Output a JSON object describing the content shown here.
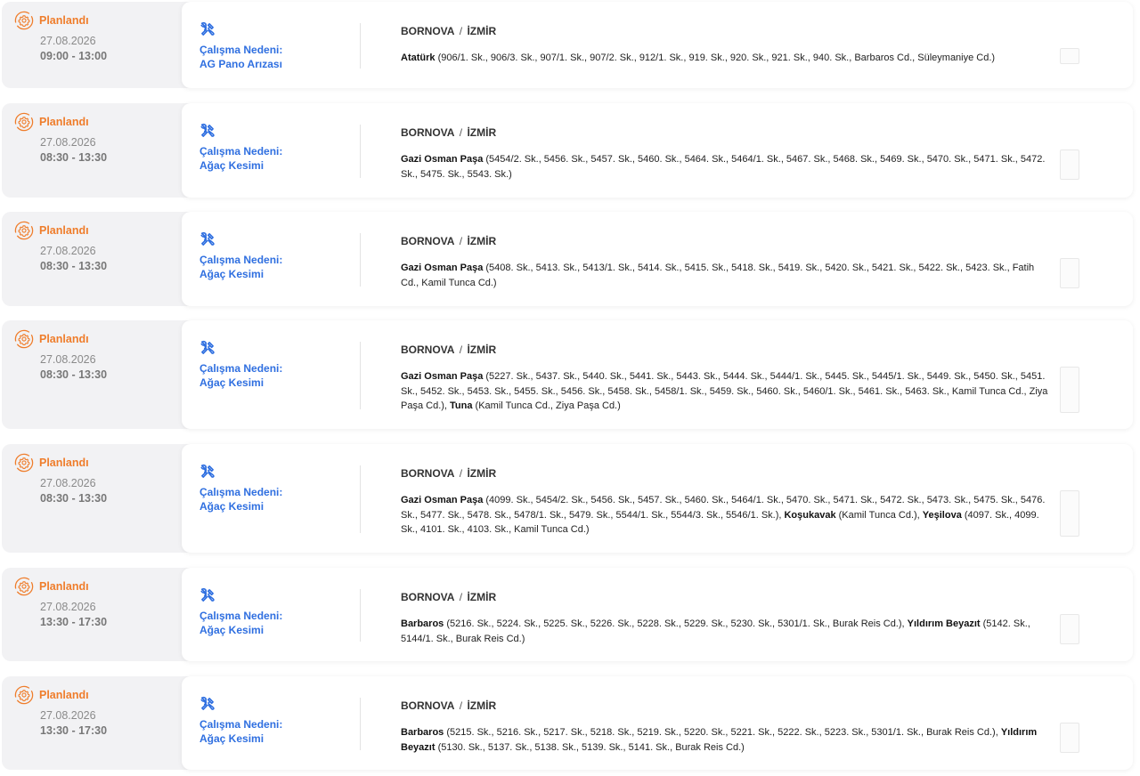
{
  "colors": {
    "status": "#ef7d2b",
    "reason": "#2f6fe0",
    "left_bg": "#f2f2f4"
  },
  "icons": {
    "status": "gear-refresh-icon",
    "reason": "tools-icon"
  },
  "outages": [
    {
      "status": "Planlandı",
      "date": "27.08.2026",
      "time": "09:00 - 13:00",
      "reason_label": "Çalışma Nedeni:",
      "reason": "AG Pano Arızası",
      "district": "BORNOVA",
      "city": "İZMİR",
      "segments": [
        {
          "name": "Atatürk",
          "streets": " (906/1. Sk., 906/3. Sk., 907/1. Sk., 907/2. Sk., 912/1. Sk., 919. Sk., 920. Sk., 921. Sk., 940. Sk., Barbaros Cd., Süleymaniye Cd.)"
        }
      ]
    },
    {
      "status": "Planlandı",
      "date": "27.08.2026",
      "time": "08:30 - 13:30",
      "reason_label": "Çalışma Nedeni:",
      "reason": "Ağaç Kesimi",
      "district": "BORNOVA",
      "city": "İZMİR",
      "segments": [
        {
          "name": "Gazi Osman Paşa",
          "streets": " (5454/2. Sk., 5456. Sk., 5457. Sk., 5460. Sk., 5464. Sk., 5464/1. Sk., 5467. Sk., 5468. Sk., 5469. Sk., 5470. Sk., 5471. Sk., 5472. Sk., 5475. Sk., 5543. Sk.)"
        }
      ]
    },
    {
      "status": "Planlandı",
      "date": "27.08.2026",
      "time": "08:30 - 13:30",
      "reason_label": "Çalışma Nedeni:",
      "reason": "Ağaç Kesimi",
      "district": "BORNOVA",
      "city": "İZMİR",
      "segments": [
        {
          "name": "Gazi Osman Paşa",
          "streets": " (5408. Sk., 5413. Sk., 5413/1. Sk., 5414. Sk., 5415. Sk., 5418. Sk., 5419. Sk., 5420. Sk., 5421. Sk., 5422. Sk., 5423. Sk., Fatih Cd., Kamil Tunca Cd.)"
        }
      ]
    },
    {
      "status": "Planlandı",
      "date": "27.08.2026",
      "time": "08:30 - 13:30",
      "reason_label": "Çalışma Nedeni:",
      "reason": "Ağaç Kesimi",
      "district": "BORNOVA",
      "city": "İZMİR",
      "segments": [
        {
          "name": "Gazi Osman Paşa",
          "streets": " (5227. Sk., 5437. Sk., 5440. Sk., 5441. Sk., 5443. Sk., 5444. Sk., 5444/1. Sk., 5445. Sk., 5445/1. Sk., 5449. Sk., 5450. Sk., 5451. Sk., 5452. Sk., 5453. Sk., 5455. Sk., 5456. Sk., 5458. Sk., 5458/1. Sk., 5459. Sk., 5460. Sk., 5460/1. Sk., 5461. Sk., 5463. Sk., Kamil Tunca Cd., Ziya Paşa Cd.), "
        },
        {
          "name": "Tuna",
          "streets": " (Kamil Tunca Cd., Ziya Paşa Cd.)"
        }
      ]
    },
    {
      "status": "Planlandı",
      "date": "27.08.2026",
      "time": "08:30 - 13:30",
      "reason_label": "Çalışma Nedeni:",
      "reason": "Ağaç Kesimi",
      "district": "BORNOVA",
      "city": "İZMİR",
      "segments": [
        {
          "name": "Gazi Osman Paşa",
          "streets": " (4099. Sk., 5454/2. Sk., 5456. Sk., 5457. Sk., 5460. Sk., 5464/1. Sk., 5470. Sk., 5471. Sk., 5472. Sk., 5473. Sk., 5475. Sk., 5476. Sk., 5477. Sk., 5478. Sk., 5478/1. Sk., 5479. Sk., 5544/1. Sk., 5544/3. Sk., 5546/1. Sk.), "
        },
        {
          "name": "Koşukavak",
          "streets": " (Kamil Tunca Cd.), "
        },
        {
          "name": "Yeşilova",
          "streets": " (4097. Sk., 4099. Sk., 4101. Sk., 4103. Sk., Kamil Tunca Cd.)"
        }
      ]
    },
    {
      "status": "Planlandı",
      "date": "27.08.2026",
      "time": "13:30 - 17:30",
      "reason_label": "Çalışma Nedeni:",
      "reason": "Ağaç Kesimi",
      "district": "BORNOVA",
      "city": "İZMİR",
      "segments": [
        {
          "name": "Barbaros",
          "streets": " (5216. Sk., 5224. Sk., 5225. Sk., 5226. Sk., 5228. Sk., 5229. Sk., 5230. Sk., 5301/1. Sk., Burak Reis Cd.), "
        },
        {
          "name": "Yıldırım Beyazıt",
          "streets": " (5142. Sk., 5144/1. Sk., Burak Reis Cd.)"
        }
      ]
    },
    {
      "status": "Planlandı",
      "date": "27.08.2026",
      "time": "13:30 - 17:30",
      "reason_label": "Çalışma Nedeni:",
      "reason": "Ağaç Kesimi",
      "district": "BORNOVA",
      "city": "İZMİR",
      "segments": [
        {
          "name": "Barbaros",
          "streets": " (5215. Sk., 5216. Sk., 5217. Sk., 5218. Sk., 5219. Sk., 5220. Sk., 5221. Sk., 5222. Sk., 5223. Sk., 5301/1. Sk., Burak Reis Cd.), "
        },
        {
          "name": "Yıldırım Beyazıt",
          "streets": " (5130. Sk., 5137. Sk., 5138. Sk., 5139. Sk., 5141. Sk., Burak Reis Cd.)"
        }
      ]
    }
  ]
}
